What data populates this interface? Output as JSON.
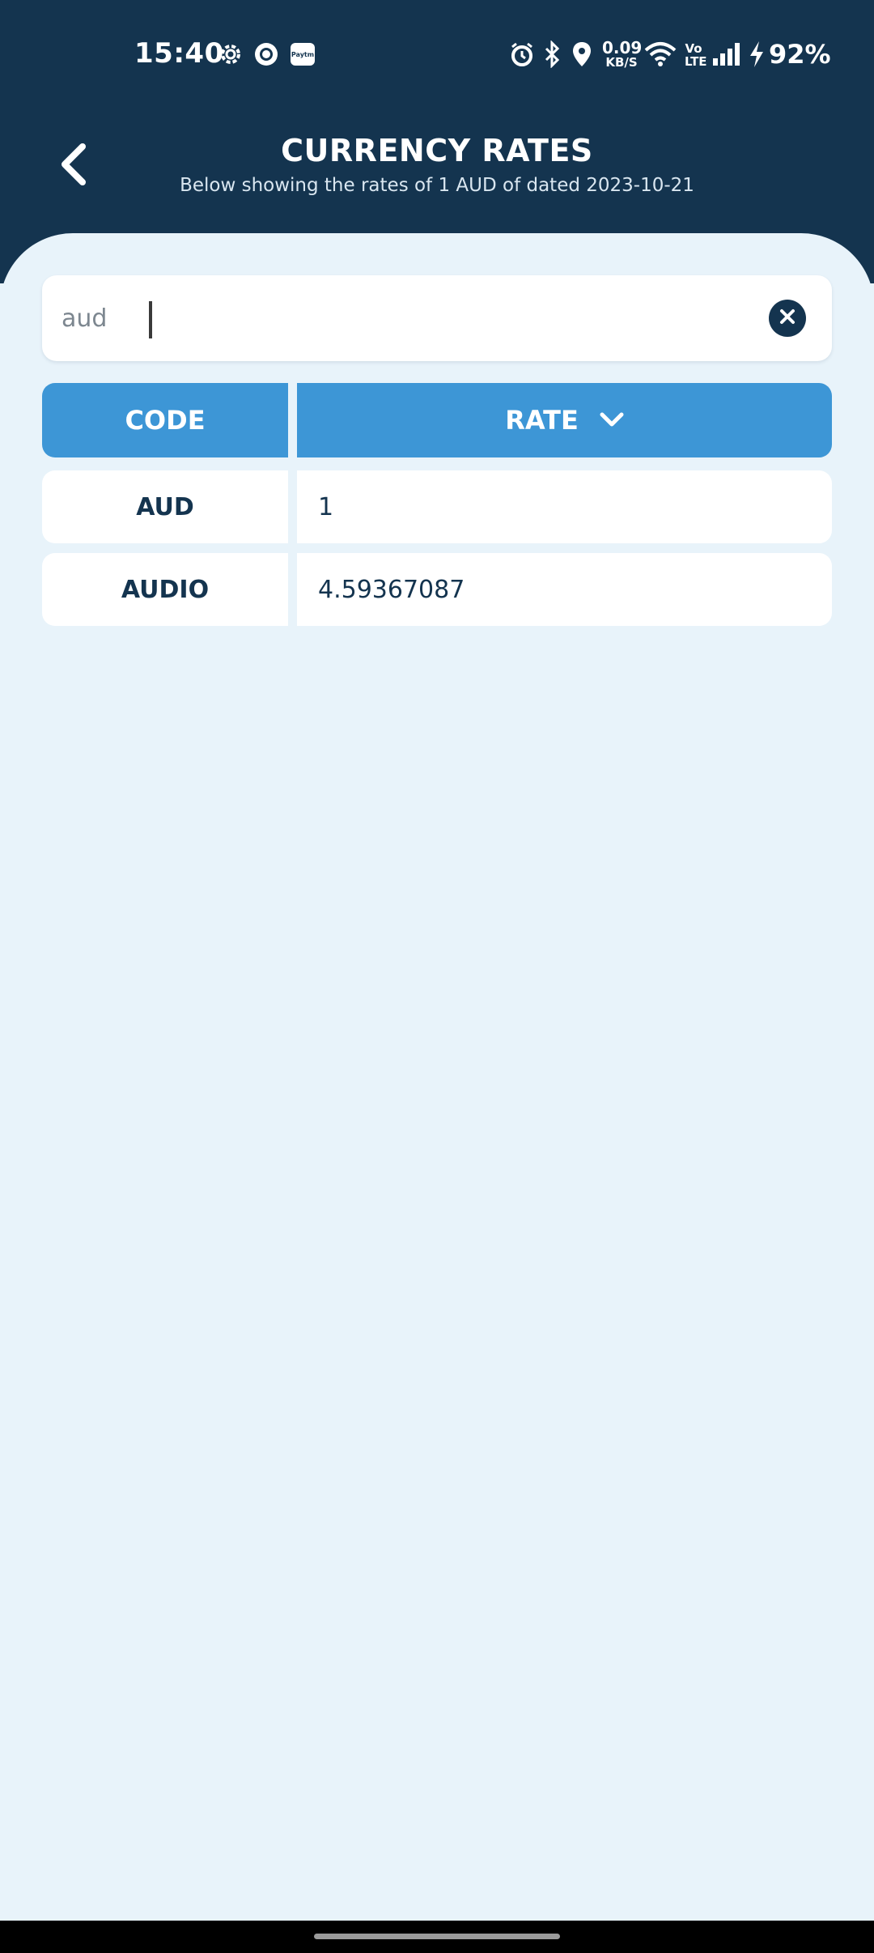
{
  "status_bar": {
    "time": "15:40",
    "left_icons": [
      "gear-icon",
      "circle-app-icon",
      "paytm-icon"
    ],
    "paytm_label": "Paytm",
    "net_speed_value": "0.09",
    "net_speed_unit": "KB/S",
    "volte_line1": "Vo",
    "volte_line2": "LTE",
    "battery": "92%"
  },
  "header": {
    "title": "CURRENCY RATES",
    "subtitle": "Below showing the rates of 1 AUD of dated 2023-10-21"
  },
  "search": {
    "value": "aud",
    "placeholder": ""
  },
  "table": {
    "code_header": "CODE",
    "rate_header": "RATE",
    "rows": [
      {
        "code": "AUD",
        "rate": "1"
      },
      {
        "code": "AUDIO",
        "rate": "4.59367087"
      }
    ]
  },
  "colors": {
    "header_bg": "#14344f",
    "accent": "#3d96d6",
    "page_bg": "#e8f3fa"
  }
}
